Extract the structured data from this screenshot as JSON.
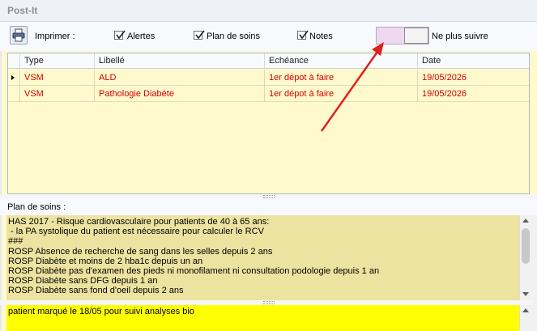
{
  "window": {
    "title": "Post-It"
  },
  "toolbar": {
    "print_label": "Imprimer :",
    "checkboxes": [
      {
        "label": "Alertes",
        "checked": true
      },
      {
        "label": "Plan de soins",
        "checked": true
      },
      {
        "label": "Notes",
        "checked": true
      }
    ],
    "toggle_label": "Ne plus suivre",
    "toggle_on": false
  },
  "grid": {
    "columns": [
      "Type",
      "Libellé",
      "Echéance",
      "Date"
    ],
    "rows": [
      [
        "VSM",
        "ALD",
        "1er dépot à faire",
        "19/05/2026"
      ],
      [
        "VSM",
        "Pathologie Diabète",
        "1er dépot à faire",
        "19/05/2026"
      ]
    ]
  },
  "plan": {
    "label": "Plan de soins :",
    "lines": [
      "HAS 2017 - Risque cardiovasculaire pour patients de 40 à 65 ans:",
      " - la PA systolique du patient est nécessaire pour calculer le RCV",
      "###",
      "ROSP Absence de recherche de sang dans les selles depuis 2 ans",
      "ROSP Diabète et moins de 2 hba1c depuis un an",
      "ROSP Diabète pas d'examen des pieds ni monofilament ni consultation podologie depuis 1 an",
      "ROSP Diabète sans DFG depuis 1 an",
      "ROSP Diabète sans fond d'oeil depuis 2 ans"
    ]
  },
  "notes": {
    "text": "patient marqué le 18/05 pour suivi analyses bio"
  },
  "colors": {
    "row_text": "#d40000",
    "grid_bg": "#fffacd",
    "plan_bg": "#ede3a0",
    "notes_bg": "#ffff00",
    "annotation_arrow": "#e02020"
  }
}
